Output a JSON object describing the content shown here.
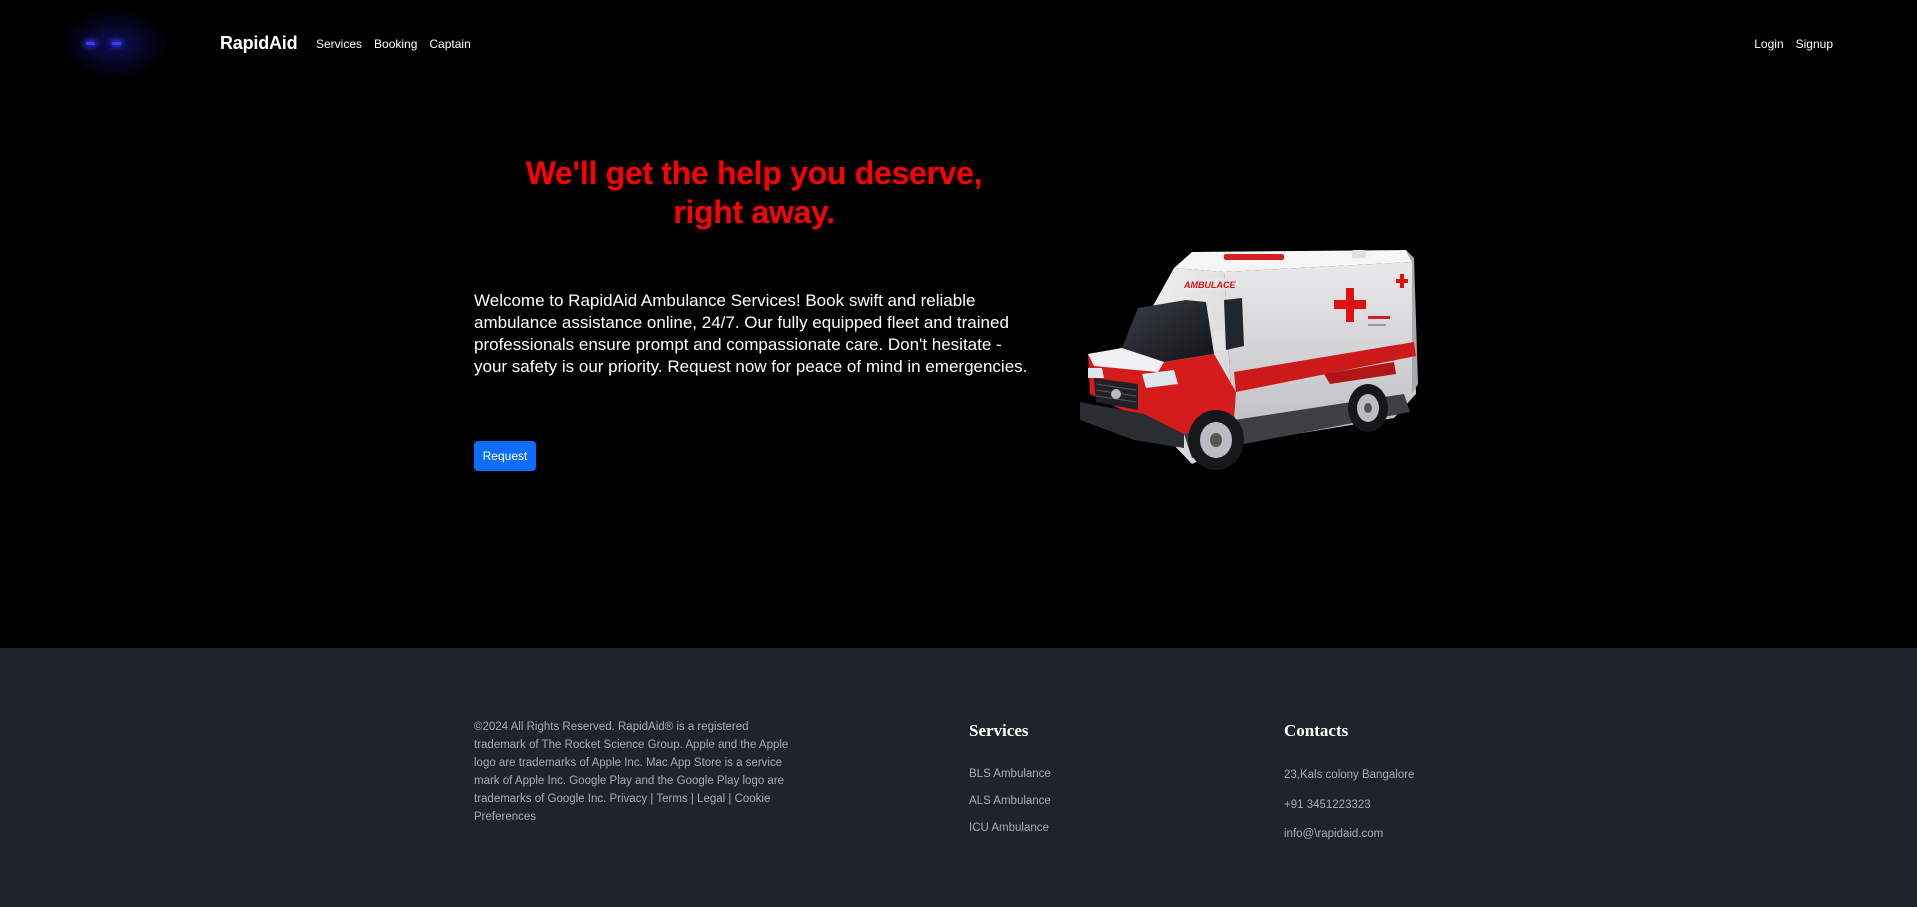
{
  "navbar": {
    "brand": "RapidAid",
    "links": [
      {
        "label": "Services"
      },
      {
        "label": "Booking"
      },
      {
        "label": "Captain"
      }
    ],
    "right_links": [
      {
        "label": "Login"
      },
      {
        "label": "Signup"
      }
    ]
  },
  "hero": {
    "title_line1": "We'll get the help you deserve,",
    "title_line2": "right away.",
    "description": "Welcome to RapidAid Ambulance Services! Book swift and reliable ambulance assistance online, 24/7. Our fully equipped fleet and trained professionals ensure prompt and compassionate care. Don't hesitate - your safety is our priority. Request now for peace of mind in emergencies.",
    "request_label": "Request",
    "ambulance_decal": "AMBULACE"
  },
  "footer": {
    "copyright": "©2024 All Rights Reserved. RapidAid® is a registered trademark of The Rocket Science Group. Apple and the Apple logo are trademarks of Apple Inc. Mac App Store is a service mark of Apple Inc. Google Play and the Google Play logo are trademarks of Google Inc. Privacy | Terms | Legal | Cookie Preferences",
    "services_heading": "Services",
    "services": [
      "BLS Ambulance",
      "ALS Ambulance",
      "ICU Ambulance"
    ],
    "contacts_heading": "Contacts",
    "contacts": [
      "23,Kals colony Bangalore",
      "+91 3451223323",
      "info@\\rapidaid.com"
    ]
  },
  "colors": {
    "background": "#000000",
    "accent_red": "#ff0000",
    "button_blue": "#0d6efd",
    "footer_bg": "#1f232b",
    "footer_text": "#a7adb7"
  },
  "icons": {
    "logo": "glowing-eyes-logo-icon",
    "hero_image": "ambulance-van-image"
  }
}
